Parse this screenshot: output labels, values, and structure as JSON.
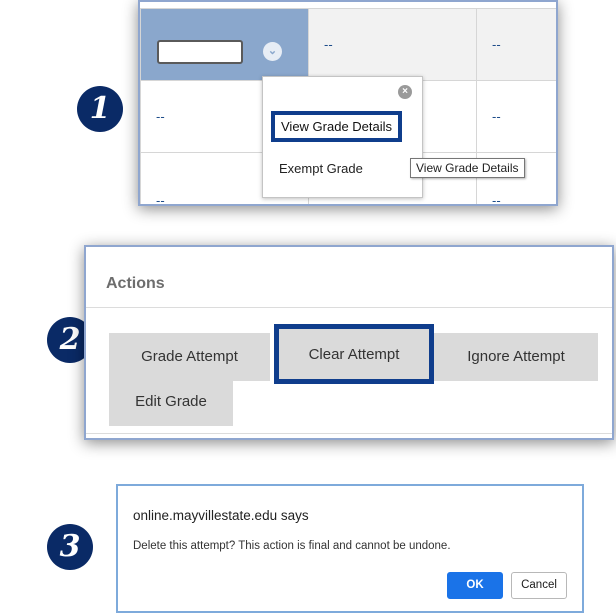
{
  "steps": [
    "1",
    "2",
    "3"
  ],
  "grade_grid": {
    "rows": [
      [
        "",
        "--",
        "--"
      ],
      [
        "--",
        "",
        "--"
      ],
      [
        "--",
        "",
        "--"
      ]
    ],
    "menu": {
      "items": [
        "View Grade Details",
        "Exempt Grade"
      ],
      "tooltip": "View Grade Details"
    }
  },
  "actions": {
    "title": "Actions",
    "buttons": [
      "Grade Attempt",
      "Clear Attempt",
      "Ignore Attempt",
      "Edit Grade"
    ]
  },
  "dialog": {
    "title": "online.mayvillestate.edu says",
    "message": "Delete this attempt? This action is final and cannot be undone.",
    "ok_label": "OK",
    "cancel_label": "Cancel"
  },
  "colors": {
    "highlight": "#0f3d8c",
    "badge": "#0a2a66",
    "active_cell": "#8aa7cc",
    "ok_button": "#1a73e8"
  }
}
